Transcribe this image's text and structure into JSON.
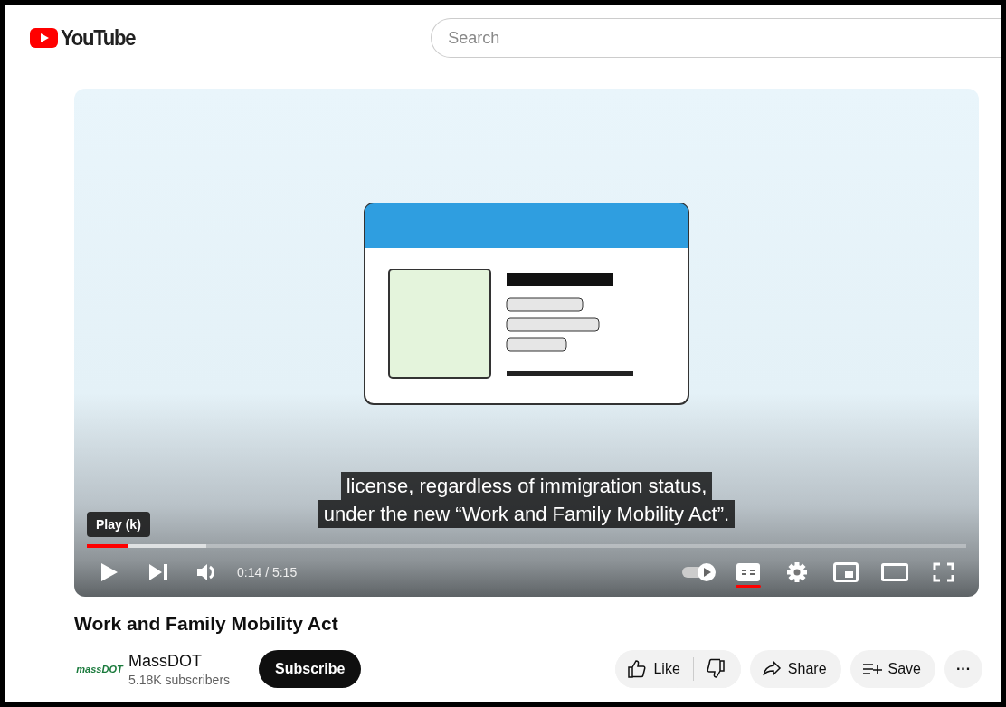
{
  "header": {
    "logo_text": "YouTube",
    "search": {
      "placeholder": "Search"
    }
  },
  "player": {
    "tooltip": "Play (k)",
    "captions": [
      "license, regardless of immigration status,",
      "under the new “Work and Family Mobility Act”."
    ],
    "progress": {
      "level": 0.046,
      "buffer": {
        "level": 0.136
      }
    },
    "time": "0:14 / 5:15",
    "captions_on": true
  },
  "video_title": "Work and Family Mobility Act",
  "channel": {
    "avatar_text": "massDOT",
    "name": "MassDOT",
    "subscribers": "5.18K subscribers",
    "subscribe_label": "Subscribe"
  },
  "actions": [
    {
      "kind": "like",
      "label": "Like"
    },
    {
      "kind": "share",
      "label": "Share"
    },
    {
      "kind": "save",
      "label": "Save"
    },
    {
      "kind": "more",
      "label": "···"
    }
  ]
}
